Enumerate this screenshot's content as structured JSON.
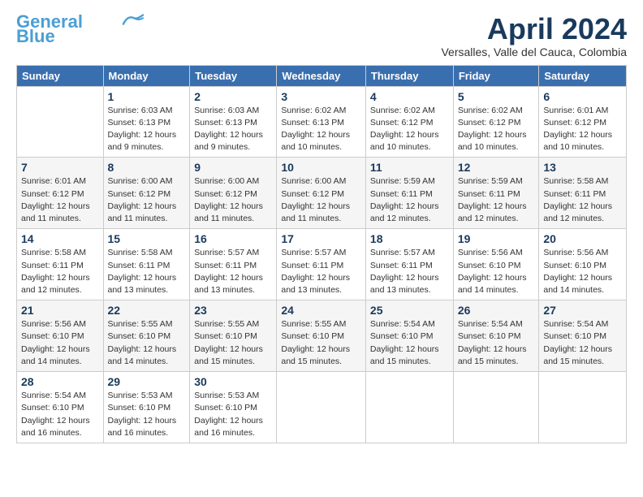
{
  "header": {
    "logo_line1": "General",
    "logo_line2": "Blue",
    "month_title": "April 2024",
    "subtitle": "Versalles, Valle del Cauca, Colombia"
  },
  "weekdays": [
    "Sunday",
    "Monday",
    "Tuesday",
    "Wednesday",
    "Thursday",
    "Friday",
    "Saturday"
  ],
  "weeks": [
    [
      {
        "day": "",
        "info": ""
      },
      {
        "day": "1",
        "info": "Sunrise: 6:03 AM\nSunset: 6:13 PM\nDaylight: 12 hours\nand 9 minutes."
      },
      {
        "day": "2",
        "info": "Sunrise: 6:03 AM\nSunset: 6:13 PM\nDaylight: 12 hours\nand 9 minutes."
      },
      {
        "day": "3",
        "info": "Sunrise: 6:02 AM\nSunset: 6:13 PM\nDaylight: 12 hours\nand 10 minutes."
      },
      {
        "day": "4",
        "info": "Sunrise: 6:02 AM\nSunset: 6:12 PM\nDaylight: 12 hours\nand 10 minutes."
      },
      {
        "day": "5",
        "info": "Sunrise: 6:02 AM\nSunset: 6:12 PM\nDaylight: 12 hours\nand 10 minutes."
      },
      {
        "day": "6",
        "info": "Sunrise: 6:01 AM\nSunset: 6:12 PM\nDaylight: 12 hours\nand 10 minutes."
      }
    ],
    [
      {
        "day": "7",
        "info": "Sunrise: 6:01 AM\nSunset: 6:12 PM\nDaylight: 12 hours\nand 11 minutes."
      },
      {
        "day": "8",
        "info": "Sunrise: 6:00 AM\nSunset: 6:12 PM\nDaylight: 12 hours\nand 11 minutes."
      },
      {
        "day": "9",
        "info": "Sunrise: 6:00 AM\nSunset: 6:12 PM\nDaylight: 12 hours\nand 11 minutes."
      },
      {
        "day": "10",
        "info": "Sunrise: 6:00 AM\nSunset: 6:12 PM\nDaylight: 12 hours\nand 11 minutes."
      },
      {
        "day": "11",
        "info": "Sunrise: 5:59 AM\nSunset: 6:11 PM\nDaylight: 12 hours\nand 12 minutes."
      },
      {
        "day": "12",
        "info": "Sunrise: 5:59 AM\nSunset: 6:11 PM\nDaylight: 12 hours\nand 12 minutes."
      },
      {
        "day": "13",
        "info": "Sunrise: 5:58 AM\nSunset: 6:11 PM\nDaylight: 12 hours\nand 12 minutes."
      }
    ],
    [
      {
        "day": "14",
        "info": "Sunrise: 5:58 AM\nSunset: 6:11 PM\nDaylight: 12 hours\nand 12 minutes."
      },
      {
        "day": "15",
        "info": "Sunrise: 5:58 AM\nSunset: 6:11 PM\nDaylight: 12 hours\nand 13 minutes."
      },
      {
        "day": "16",
        "info": "Sunrise: 5:57 AM\nSunset: 6:11 PM\nDaylight: 12 hours\nand 13 minutes."
      },
      {
        "day": "17",
        "info": "Sunrise: 5:57 AM\nSunset: 6:11 PM\nDaylight: 12 hours\nand 13 minutes."
      },
      {
        "day": "18",
        "info": "Sunrise: 5:57 AM\nSunset: 6:11 PM\nDaylight: 12 hours\nand 13 minutes."
      },
      {
        "day": "19",
        "info": "Sunrise: 5:56 AM\nSunset: 6:10 PM\nDaylight: 12 hours\nand 14 minutes."
      },
      {
        "day": "20",
        "info": "Sunrise: 5:56 AM\nSunset: 6:10 PM\nDaylight: 12 hours\nand 14 minutes."
      }
    ],
    [
      {
        "day": "21",
        "info": "Sunrise: 5:56 AM\nSunset: 6:10 PM\nDaylight: 12 hours\nand 14 minutes."
      },
      {
        "day": "22",
        "info": "Sunrise: 5:55 AM\nSunset: 6:10 PM\nDaylight: 12 hours\nand 14 minutes."
      },
      {
        "day": "23",
        "info": "Sunrise: 5:55 AM\nSunset: 6:10 PM\nDaylight: 12 hours\nand 15 minutes."
      },
      {
        "day": "24",
        "info": "Sunrise: 5:55 AM\nSunset: 6:10 PM\nDaylight: 12 hours\nand 15 minutes."
      },
      {
        "day": "25",
        "info": "Sunrise: 5:54 AM\nSunset: 6:10 PM\nDaylight: 12 hours\nand 15 minutes."
      },
      {
        "day": "26",
        "info": "Sunrise: 5:54 AM\nSunset: 6:10 PM\nDaylight: 12 hours\nand 15 minutes."
      },
      {
        "day": "27",
        "info": "Sunrise: 5:54 AM\nSunset: 6:10 PM\nDaylight: 12 hours\nand 15 minutes."
      }
    ],
    [
      {
        "day": "28",
        "info": "Sunrise: 5:54 AM\nSunset: 6:10 PM\nDaylight: 12 hours\nand 16 minutes."
      },
      {
        "day": "29",
        "info": "Sunrise: 5:53 AM\nSunset: 6:10 PM\nDaylight: 12 hours\nand 16 minutes."
      },
      {
        "day": "30",
        "info": "Sunrise: 5:53 AM\nSunset: 6:10 PM\nDaylight: 12 hours\nand 16 minutes."
      },
      {
        "day": "",
        "info": ""
      },
      {
        "day": "",
        "info": ""
      },
      {
        "day": "",
        "info": ""
      },
      {
        "day": "",
        "info": ""
      }
    ]
  ]
}
